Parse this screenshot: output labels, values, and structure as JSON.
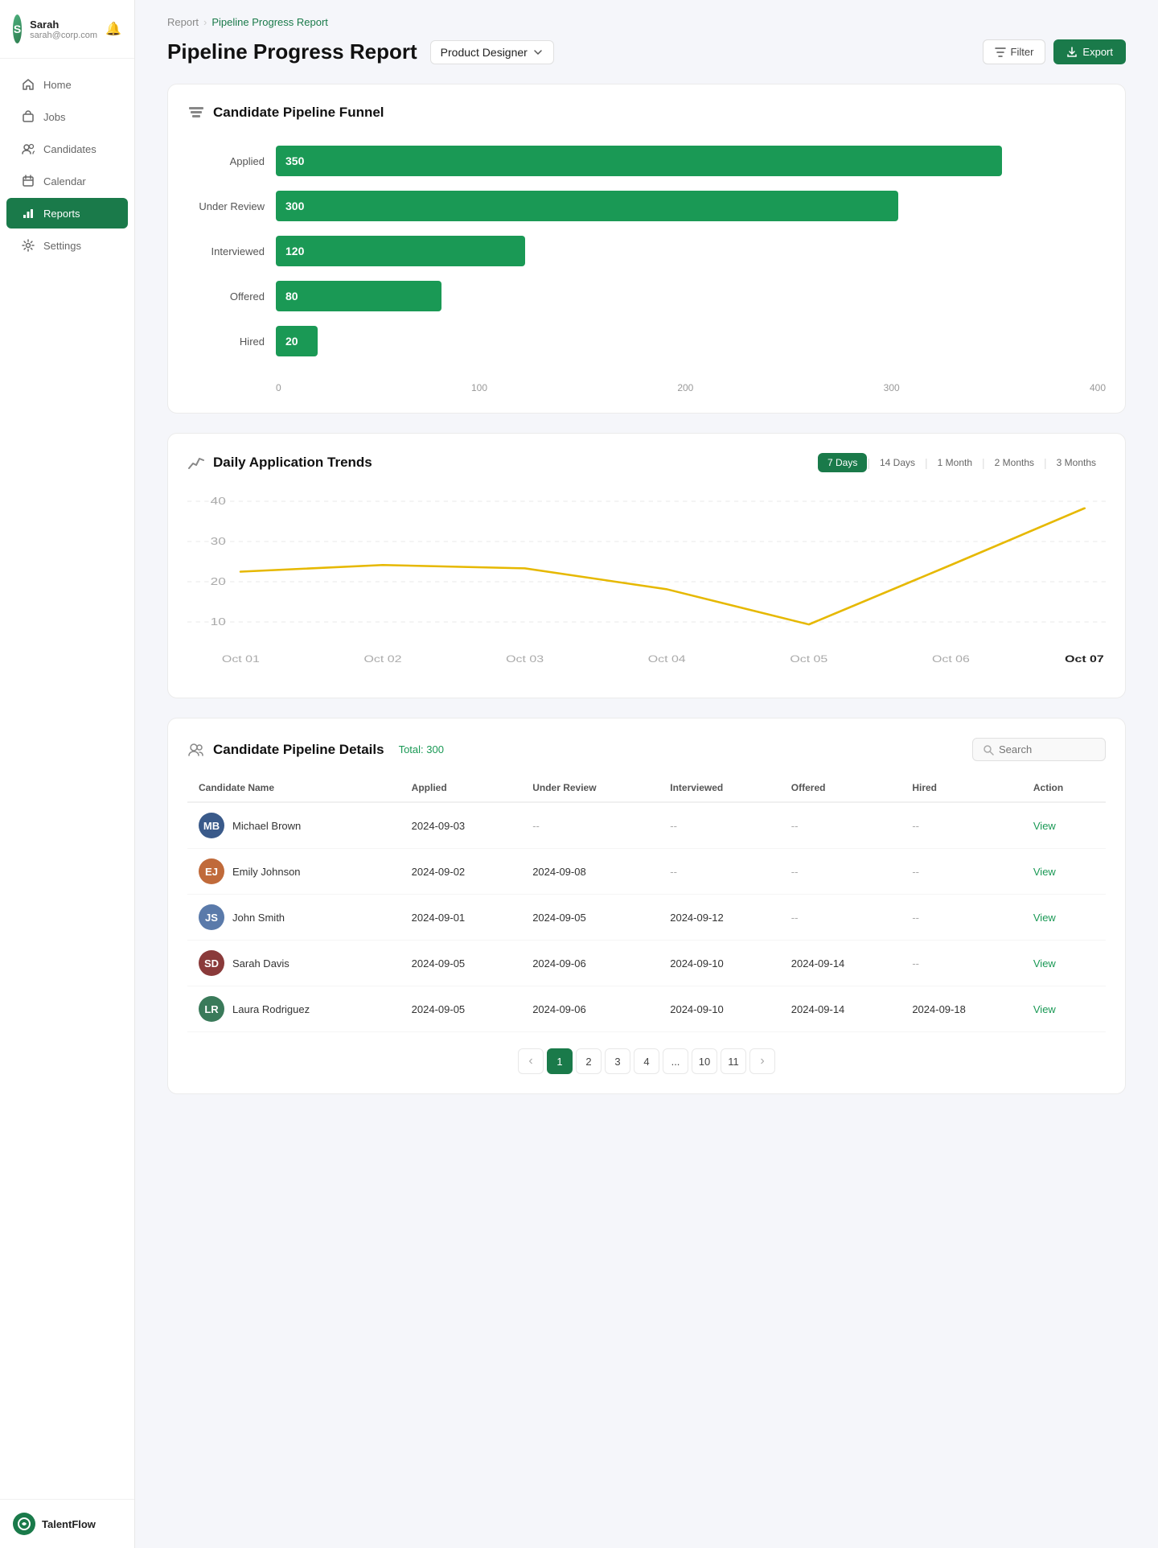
{
  "sidebar": {
    "user": {
      "name": "Sarah",
      "email": "sarah@corp.com",
      "initials": "S"
    },
    "nav": [
      {
        "id": "home",
        "label": "Home",
        "icon": "home"
      },
      {
        "id": "jobs",
        "label": "Jobs",
        "icon": "briefcase"
      },
      {
        "id": "candidates",
        "label": "Candidates",
        "icon": "users"
      },
      {
        "id": "calendar",
        "label": "Calendar",
        "icon": "calendar"
      },
      {
        "id": "reports",
        "label": "Reports",
        "icon": "bar-chart",
        "active": true
      },
      {
        "id": "settings",
        "label": "Settings",
        "icon": "settings"
      }
    ],
    "logo": "TalentFlow"
  },
  "breadcrumb": {
    "parent": "Report",
    "current": "Pipeline Progress Report"
  },
  "page": {
    "title": "Pipeline Progress Report",
    "role": "Product Designer",
    "filter_label": "Filter",
    "export_label": "Export"
  },
  "funnel": {
    "title": "Candidate Pipeline Funnel",
    "bars": [
      {
        "label": "Applied",
        "value": 350,
        "max": 400
      },
      {
        "label": "Under Review",
        "value": 300,
        "max": 400
      },
      {
        "label": "Interviewed",
        "value": 120,
        "max": 400
      },
      {
        "label": "Offered",
        "value": 80,
        "max": 400
      },
      {
        "label": "Hired",
        "value": 20,
        "max": 400
      }
    ],
    "x_axis": [
      "0",
      "100",
      "200",
      "300",
      "400"
    ]
  },
  "trend": {
    "title": "Daily Application Trends",
    "buttons": [
      "7 Days",
      "14 Days",
      "1 Month",
      "2 Months",
      "3 Months"
    ],
    "active_button": "7 Days",
    "data": [
      {
        "label": "Oct 01",
        "value": 20
      },
      {
        "label": "Oct 02",
        "value": 22
      },
      {
        "label": "Oct 03",
        "value": 21
      },
      {
        "label": "Oct 04",
        "value": 15
      },
      {
        "label": "Oct 05",
        "value": 5
      },
      {
        "label": "Oct 06",
        "value": 22
      },
      {
        "label": "Oct 07",
        "value": 38
      }
    ],
    "y_axis": [
      "40",
      "30",
      "20",
      "10"
    ],
    "bold_label": "Oct 07"
  },
  "pipeline_details": {
    "title": "Candidate Pipeline Details",
    "total_label": "Total: 300",
    "search_placeholder": "Search",
    "columns": [
      "Candidate Name",
      "Applied",
      "Under Review",
      "Interviewed",
      "Offered",
      "Hired",
      "Action"
    ],
    "rows": [
      {
        "name": "Michael Brown",
        "initials": "MB",
        "color": "#3a5a8a",
        "applied": "2024-09-03",
        "under_review": "--",
        "interviewed": "--",
        "offered": "--",
        "hired": "--"
      },
      {
        "name": "Emily Johnson",
        "initials": "EJ",
        "color": "#c06a3a",
        "applied": "2024-09-02",
        "under_review": "2024-09-08",
        "interviewed": "--",
        "offered": "--",
        "hired": "--"
      },
      {
        "name": "John Smith",
        "initials": "JS",
        "color": "#5a7aaa",
        "applied": "2024-09-01",
        "under_review": "2024-09-05",
        "interviewed": "2024-09-12",
        "offered": "--",
        "hired": "--"
      },
      {
        "name": "Sarah Davis",
        "initials": "SD",
        "color": "#8a3a3a",
        "applied": "2024-09-05",
        "under_review": "2024-09-06",
        "interviewed": "2024-09-10",
        "offered": "2024-09-14",
        "hired": "--"
      },
      {
        "name": "Laura Rodriguez",
        "initials": "LR",
        "color": "#3a7a5a",
        "applied": "2024-09-05",
        "under_review": "2024-09-06",
        "interviewed": "2024-09-10",
        "offered": "2024-09-14",
        "hired": "2024-09-18"
      }
    ]
  },
  "pagination": {
    "pages": [
      "1",
      "2",
      "3",
      "4",
      "...",
      "10",
      "11"
    ],
    "current": "1"
  }
}
